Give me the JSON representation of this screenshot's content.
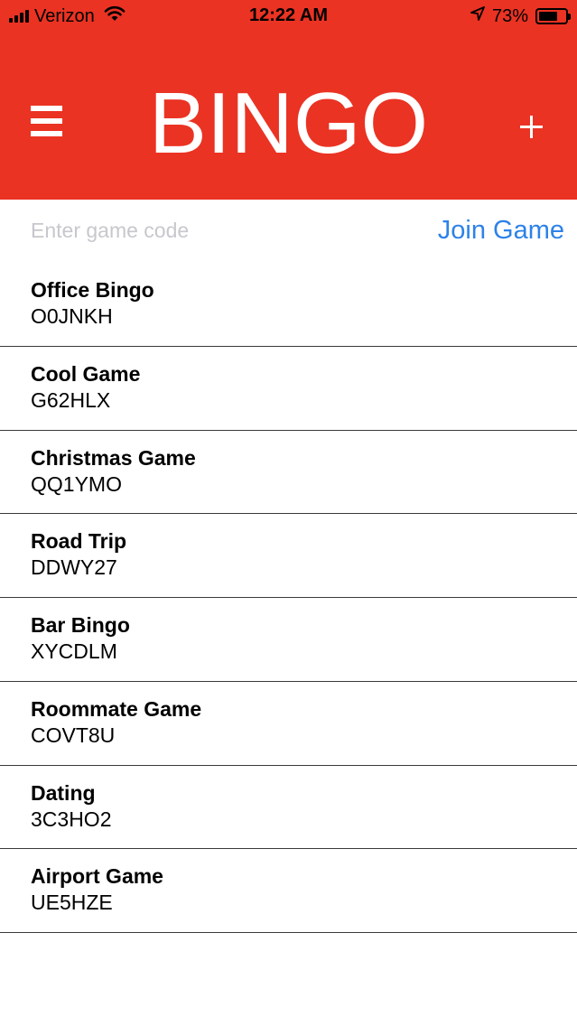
{
  "status_bar": {
    "carrier": "Verizon",
    "time": "12:22 AM",
    "battery_percent": "73%",
    "battery_level": 0.73,
    "signal_icon": "signal-bars-icon",
    "wifi_icon": "wifi-icon",
    "location_icon": "location-arrow-icon"
  },
  "header": {
    "title": "BINGO",
    "menu_icon": "hamburger-menu-icon",
    "add_icon": "plus-icon",
    "background_color": "#ea3323"
  },
  "join": {
    "input_value": "",
    "placeholder": "Enter game code",
    "button_label": "Join Game",
    "button_color": "#2d82e8"
  },
  "games": [
    {
      "name": "Office Bingo",
      "code": "O0JNKH"
    },
    {
      "name": "Cool Game",
      "code": "G62HLX"
    },
    {
      "name": "Christmas Game",
      "code": "QQ1YMO"
    },
    {
      "name": "Road Trip",
      "code": "DDWY27"
    },
    {
      "name": "Bar Bingo",
      "code": "XYCDLM"
    },
    {
      "name": "Roommate Game",
      "code": "COVT8U"
    },
    {
      "name": "Dating",
      "code": "3C3HO2"
    },
    {
      "name": "Airport Game",
      "code": "UE5HZE"
    }
  ]
}
